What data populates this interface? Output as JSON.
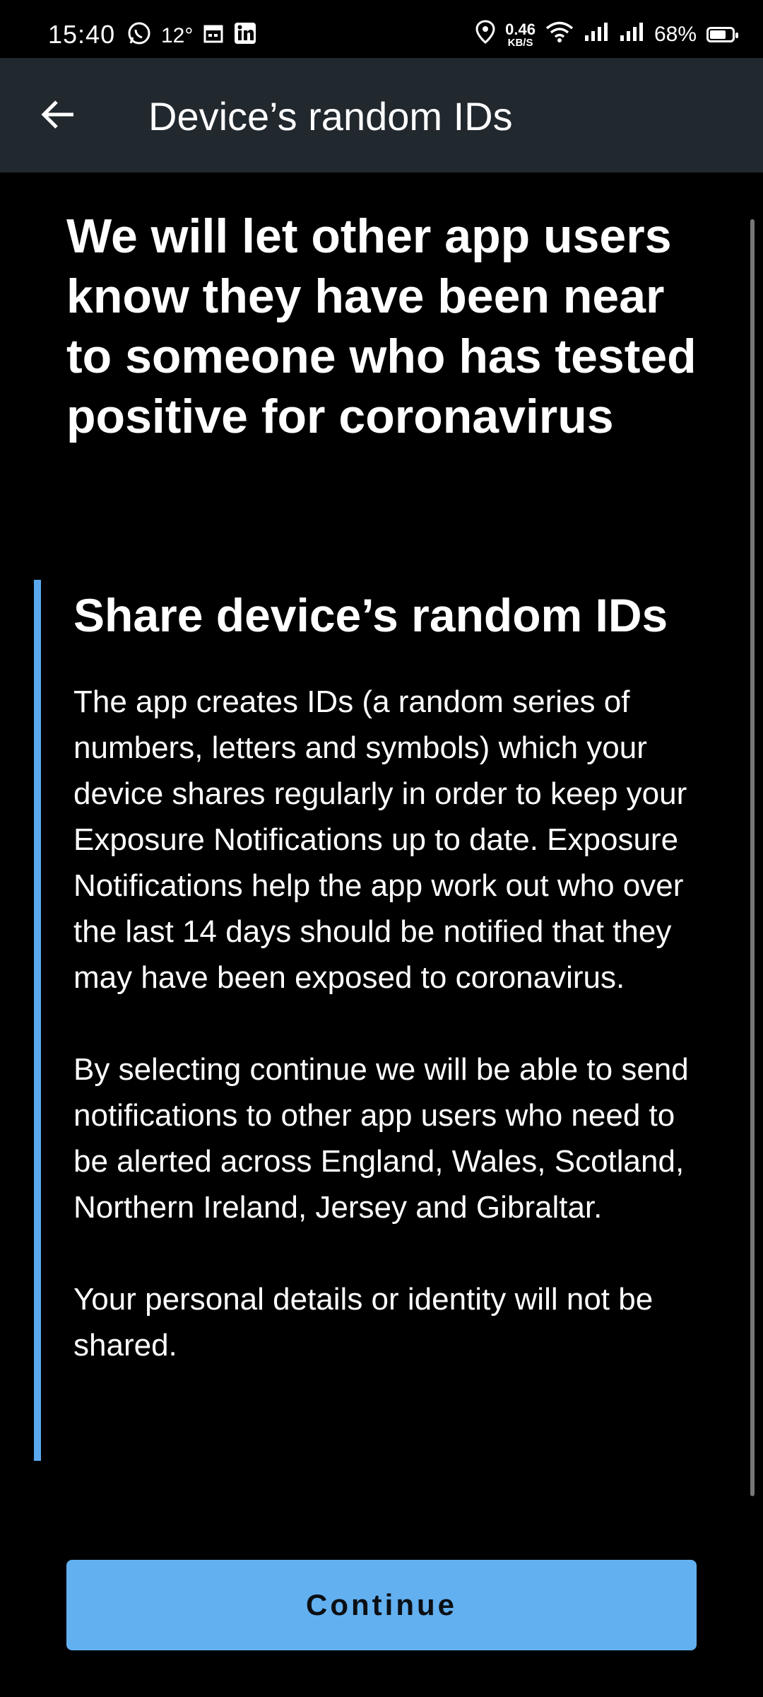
{
  "status_bar": {
    "time": "15:40",
    "temperature": "12°",
    "speed_value": "0.46",
    "speed_unit": "KB/S",
    "battery": "68%",
    "icons": [
      "whatsapp-icon",
      "calendar-icon",
      "linkedin-icon",
      "location-icon",
      "wifi-icon",
      "signal-icon",
      "signal-icon",
      "battery-icon"
    ]
  },
  "app_bar": {
    "title": "Device’s random IDs",
    "back_icon": "arrow-left-icon"
  },
  "content": {
    "headline": "We will let other app users know they have been near to someone who has tested positive for coronavirus",
    "callout": {
      "title": "Share device’s random IDs",
      "paragraphs": [
        "The app creates IDs (a random series of numbers, letters and symbols) which your device shares regularly in order to keep your Exposure Notifications up to date. Exposure Notifications help the app work out who over the last 14 days should be notified that they may have been exposed to coronavirus.",
        "By selecting continue we will be able to send notifications to other app users who need to be alerted across England, Wales, Scotland, Northern Ireland, Jersey and Gibraltar.",
        "Your personal details or identity will not be shared."
      ]
    }
  },
  "actions": {
    "continue_label": "Continue"
  },
  "colors": {
    "app_bar_bg": "#21282e",
    "accent": "#5aa9f0",
    "button_bg": "#63b0f0",
    "page_bg": "#000000"
  }
}
